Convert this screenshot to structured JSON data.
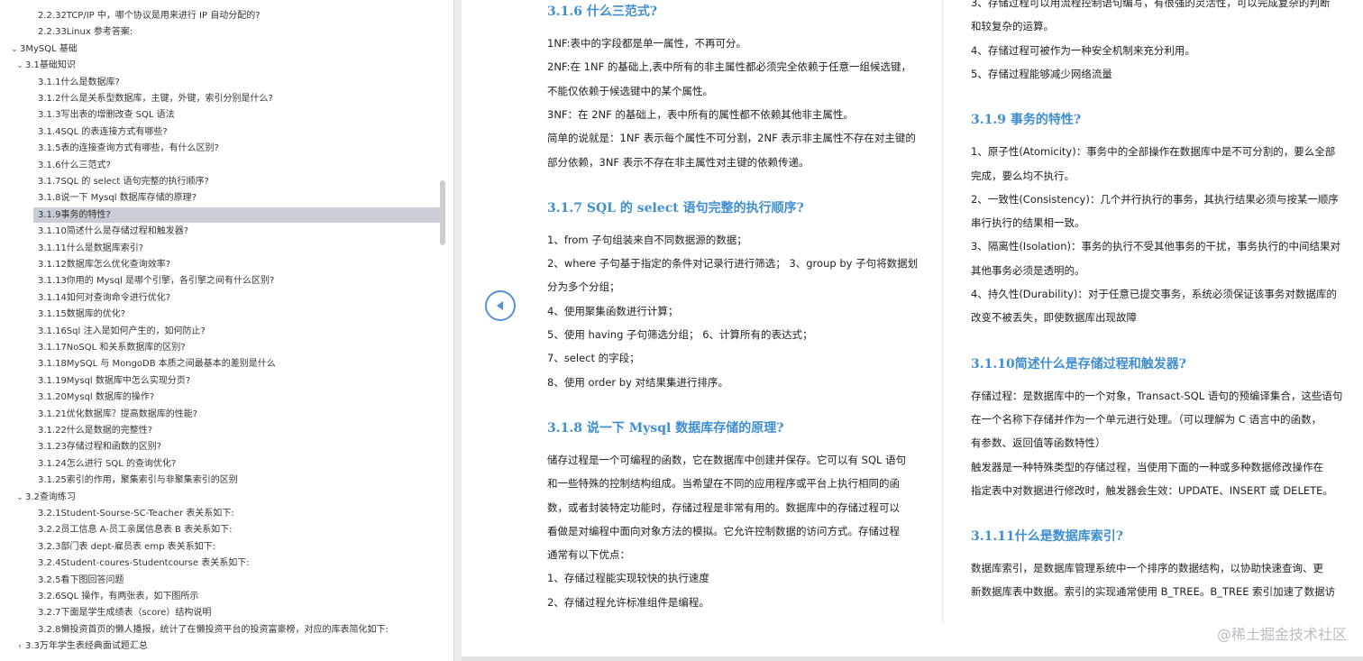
{
  "sidebar": {
    "items": [
      {
        "label": "2.2.32TCP/IP 中，哪个协议是用来进行 IP 自动分配的?",
        "level": 2
      },
      {
        "label": "2.2.33Linux 参考答案:",
        "level": 2
      },
      {
        "label": "3MySQL 基础",
        "level": 0,
        "arrow": "⌄"
      },
      {
        "label": "3.1基础知识",
        "level": 1,
        "arrow": "⌄"
      },
      {
        "label": "3.1.1什么是数据库?",
        "level": 2
      },
      {
        "label": "3.1.2什么是关系型数据库，主键，外键，索引分别是什么?",
        "level": 2
      },
      {
        "label": "3.1.3写出表的增删改查 SQL 语法",
        "level": 2
      },
      {
        "label": "3.1.4SQL 的表连接方式有哪些?",
        "level": 2
      },
      {
        "label": "3.1.5表的连接查询方式有哪些，有什么区别?",
        "level": 2
      },
      {
        "label": "3.1.6什么三范式?",
        "level": 2
      },
      {
        "label": "3.1.7SQL 的 select 语句完整的执行顺序?",
        "level": 2
      },
      {
        "label": "3.1.8说一下 Mysql 数据库存储的原理?",
        "level": 2
      },
      {
        "label": "3.1.9事务的特性?",
        "level": 2,
        "selected": true
      },
      {
        "label": "3.1.10简述什么是存储过程和触发器?",
        "level": 2
      },
      {
        "label": "3.1.11什么是数据库索引?",
        "level": 2
      },
      {
        "label": "3.1.12数据库怎么优化查询效率?",
        "level": 2
      },
      {
        "label": "3.1.13你用的 Mysql 是哪个引擎，各引擎之间有什么区别?",
        "level": 2
      },
      {
        "label": "3.1.14如何对查询命令进行优化?",
        "level": 2
      },
      {
        "label": "3.1.15数据库的优化?",
        "level": 2
      },
      {
        "label": "3.1.16Sql 注入是如何产生的，如何防止?",
        "level": 2
      },
      {
        "label": "3.1.17NoSQL 和关系数据库的区别?",
        "level": 2
      },
      {
        "label": "3.1.18MySQL 与 MongoDB 本质之间最基本的差别是什么",
        "level": 2
      },
      {
        "label": "3.1.19Mysql 数据库中怎么实现分页?",
        "level": 2
      },
      {
        "label": "3.1.20Mysql 数据库的操作?",
        "level": 2
      },
      {
        "label": "3.1.21优化数据库？提高数据库的性能?",
        "level": 2
      },
      {
        "label": "3.1.22什么是数据的完整性?",
        "level": 2
      },
      {
        "label": "3.1.23存储过程和函数的区别?",
        "level": 2
      },
      {
        "label": "3.1.24怎么进行 SQL 的查询优化?",
        "level": 2
      },
      {
        "label": "3.1.25索引的作用，聚集索引与非聚集索引的区别",
        "level": 2
      },
      {
        "label": "3.2查询练习",
        "level": 1,
        "arrow": "⌄"
      },
      {
        "label": "3.2.1Student-Sourse-SC-Teacher 表关系如下:",
        "level": 2
      },
      {
        "label": "3.2.2员工信息 A-员工亲属信息表 B 表关系如下:",
        "level": 2
      },
      {
        "label": "3.2.3部门表 dept-雇员表 emp 表关系如下:",
        "level": 2
      },
      {
        "label": "3.2.4Student-coures-Studentcourse 表关系如下:",
        "level": 2
      },
      {
        "label": "3.2.5看下图回答问题",
        "level": 2
      },
      {
        "label": "3.2.6SQL 操作，有两张表，如下图所示",
        "level": 2
      },
      {
        "label": "3.2.7下面是学生成绩表（score）结构说明",
        "level": 2
      },
      {
        "label": "3.2.8懒投资首页的懒人播报，统计了在懒投资平台的投资富豪榜，对应的库表简化如下:",
        "level": 2
      },
      {
        "label": "3.3万年学生表经典面试题汇总",
        "level": 1,
        "arrow": "›"
      }
    ]
  },
  "doc": {
    "left": [
      {
        "t": "h",
        "text": "3.1.6  什么三范式?"
      },
      {
        "t": "p",
        "text": "1NF:表中的字段都是单一属性，不再可分。"
      },
      {
        "t": "p",
        "text": "2NF:在 1NF 的基础上,表中所有的非主属性都必须完全依赖于任意一组候选键，"
      },
      {
        "t": "p",
        "text": "不能仅依赖于候选键中的某个属性。"
      },
      {
        "t": "p",
        "text": "3NF：在 2NF 的基础上，表中所有的属性都不依赖其他非主属性。"
      },
      {
        "t": "p",
        "text": "简单的说就是：1NF 表示每个属性不可分割，2NF 表示非主属性不存在对主键的"
      },
      {
        "t": "p",
        "text": "部分依赖，3NF 表示不存在非主属性对主键的依赖传递。"
      },
      {
        "t": "h",
        "text": "3.1.7  SQL  的  select  语句完整的执行顺序?"
      },
      {
        "t": "p",
        "text": "1、from    子句组装来自不同数据源的数据；"
      },
      {
        "t": "p",
        "text": "2、where  子句基于指定的条件对记录行进行筛选；  3、group by  子句将数据划"
      },
      {
        "t": "p",
        "text": "分为多个分组；"
      },
      {
        "t": "p",
        "text": "4、使用聚集函数进行计算；"
      },
      {
        "t": "p",
        "text": "5、使用  having  子句筛选分组；    6、计算所有的表达式；"
      },
      {
        "t": "p",
        "text": "7、select  的字段；"
      },
      {
        "t": "p",
        "text": "8、使用  order by  对结果集进行排序。"
      },
      {
        "t": "h",
        "text": "3.1.8  说一下  Mysql  数据库存储的原理?"
      },
      {
        "t": "p",
        "text": "储存过程是一个可编程的函数，它在数据库中创建并保存。它可以有  SQL  语句"
      },
      {
        "t": "p",
        "text": "和一些特殊的控制结构组成。当希望在不同的应用程序或平台上执行相同的函"
      },
      {
        "t": "p",
        "text": "数，或者封装特定功能时，存储过程是非常有用的。数据库中的存储过程可以"
      },
      {
        "t": "p",
        "text": "看做是对编程中面向对象方法的模拟。它允许控制数据的访问方式。存储过程"
      },
      {
        "t": "p",
        "text": "通常有以下优点："
      },
      {
        "t": "p",
        "text": "1、存储过程能实现较快的执行速度"
      },
      {
        "t": "p",
        "text": "2、存储过程允许标准组件是编程。"
      }
    ],
    "right": [
      {
        "t": "p",
        "text": "3、存储过程可以用流程控制语句编写，有很强的灵活性，可以完成复杂的判断"
      },
      {
        "t": "p",
        "text": "和较复杂的运算。"
      },
      {
        "t": "p",
        "text": "4、存储过程可被作为一种安全机制来充分利用。"
      },
      {
        "t": "p",
        "text": "5、存储过程能够减少网络流量"
      },
      {
        "t": "h",
        "text": "3.1.9  事务的特性?"
      },
      {
        "t": "p",
        "text": "1、原子性(Atomicity)：事务中的全部操作在数据库中是不可分割的，要么全部"
      },
      {
        "t": "p",
        "text": "完成，要么均不执行。"
      },
      {
        "t": "p",
        "text": "2、一致性(Consistency)：几个并行执行的事务，其执行结果必须与按某一顺序"
      },
      {
        "t": "p",
        "text": "串行执行的结果相一致。"
      },
      {
        "t": "p",
        "text": "3、隔离性(Isolation)：事务的执行不受其他事务的干扰，事务执行的中间结果对"
      },
      {
        "t": "p",
        "text": "其他事务必须是透明的。"
      },
      {
        "t": "p",
        "text": "4、持久性(Durability)：对于任意已提交事务，系统必须保证该事务对数据库的"
      },
      {
        "t": "p",
        "text": "改变不被丢失，即使数据库出现故障"
      },
      {
        "t": "h",
        "text": "3.1.10简述什么是存储过程和触发器?"
      },
      {
        "t": "p",
        "text": "存储过程：是数据库中的一个对象，Transact-SQL 语句的预编译集合，这些语句"
      },
      {
        "t": "p",
        "text": "在一个名称下存储并作为一个单元进行处理。（可以理解为 C 语言中的函数，"
      },
      {
        "t": "p",
        "text": "有参数、返回值等函数特性）"
      },
      {
        "t": "p",
        "text": "触发器是一种特殊类型的存储过程，当使用下面的一种或多种数据修改操作在"
      },
      {
        "t": "p",
        "text": "指定表中对数据进行修改时，触发器会生效：UPDATE、INSERT 或  DELETE。"
      },
      {
        "t": "h",
        "text": "3.1.11什么是数据库索引?"
      },
      {
        "t": "p",
        "text": "数据库索引，是数据库管理系统中一个排序的数据结构，以协助快速查询、更"
      },
      {
        "t": "p",
        "text": "新数据库表中数据。索引的实现通常使用  B_TREE。B_TREE  索引加速了数据访"
      }
    ]
  },
  "watermark": "@稀土掘金技术社区",
  "icons": {
    "prev": "chevron-left-icon"
  }
}
